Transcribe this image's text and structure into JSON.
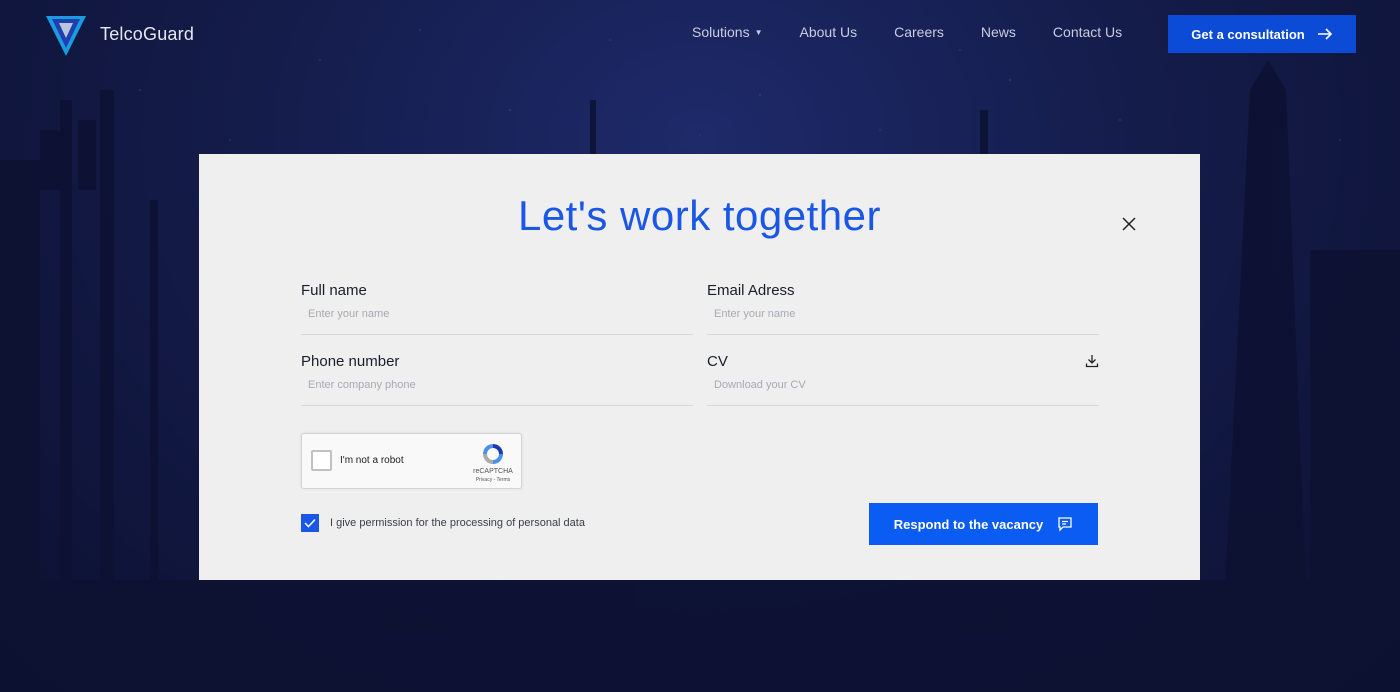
{
  "brand": {
    "name": "TelcoGuard"
  },
  "nav": {
    "items": [
      {
        "label": "Solutions",
        "has_dropdown": true
      },
      {
        "label": "About Us"
      },
      {
        "label": "Careers"
      },
      {
        "label": "News"
      },
      {
        "label": "Contact Us"
      }
    ],
    "cta_label": "Get a consultation"
  },
  "modal": {
    "title": "Let's work together",
    "fields": {
      "full_name": {
        "label": "Full name",
        "placeholder": "Enter your name",
        "value": ""
      },
      "email": {
        "label": "Email Adress",
        "placeholder": "Enter your name",
        "value": ""
      },
      "phone": {
        "label": "Phone number",
        "placeholder": "Enter company phone",
        "value": ""
      },
      "cv": {
        "label": "CV",
        "placeholder": "Download your CV",
        "value": "",
        "icon": "download-icon"
      }
    },
    "captcha": {
      "label": "I'm not a robot",
      "brand": "reCAPTCHA",
      "links": "Privacy - Terms",
      "checked": false
    },
    "permission": {
      "label": "I give permission for the processing of personal data",
      "checked": true
    },
    "submit_label": "Respond to the vacancy"
  },
  "colors": {
    "accent": "#1b57e5",
    "cta": "#0b4bd6",
    "background": "#11163a",
    "modal_bg": "#efefef"
  }
}
